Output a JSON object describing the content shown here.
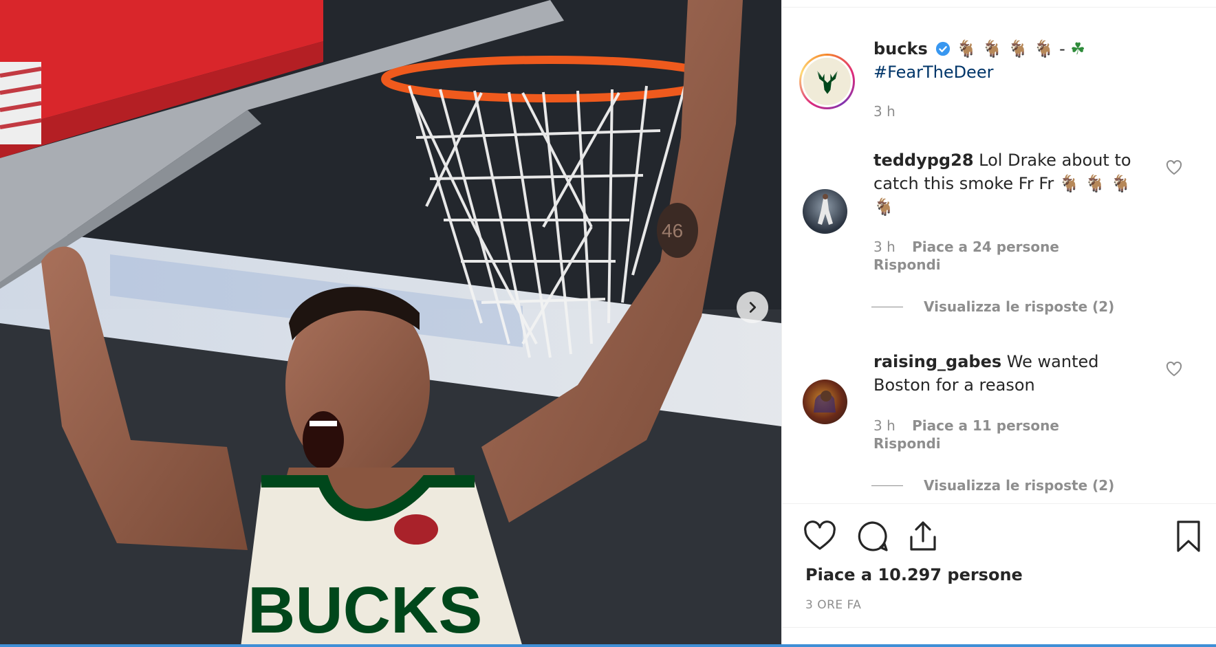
{
  "post": {
    "username": "bucks",
    "caption_emoji": "🐐 🐐 🐐 🐐",
    "caption_dash": "-",
    "caption_clover": "☘",
    "hashtag": "#FearTheDeer",
    "caption_time": "3 h"
  },
  "photo": {
    "jersey_text": "BUCKS",
    "tattoo_number": "46"
  },
  "comments": [
    {
      "username": "teddypg28",
      "text": "Lol Drake about to catch this smoke Fr Fr",
      "emoji_line1": "🐐 🐐 🐐",
      "emoji_line2": "🐐",
      "time": "3 h",
      "likes": "Piace a 24 persone",
      "reply": "Rispondi",
      "view_replies": "Visualizza le risposte (2)"
    },
    {
      "username": "raising_gabes",
      "text": "We wanted Boston for a reason",
      "time": "3 h",
      "likes": "Piace a 11 persone",
      "reply": "Rispondi",
      "view_replies": "Visualizza le risposte (2)"
    }
  ],
  "footer": {
    "likes_count": "Piace a 10.297 persone",
    "post_age": "3 ORE FA"
  },
  "icons": {
    "like": "heart-icon",
    "comment": "comment-icon",
    "share": "share-icon",
    "save": "bookmark-icon",
    "next": "chevron-right-icon",
    "verified": "verified-badge-icon"
  },
  "colors": {
    "link_blue": "#003569",
    "verified_blue": "#3897f0",
    "muted_gray": "#8e8e8e",
    "bucks_green": "#00471b",
    "bucks_cream": "#f0ebd8"
  }
}
